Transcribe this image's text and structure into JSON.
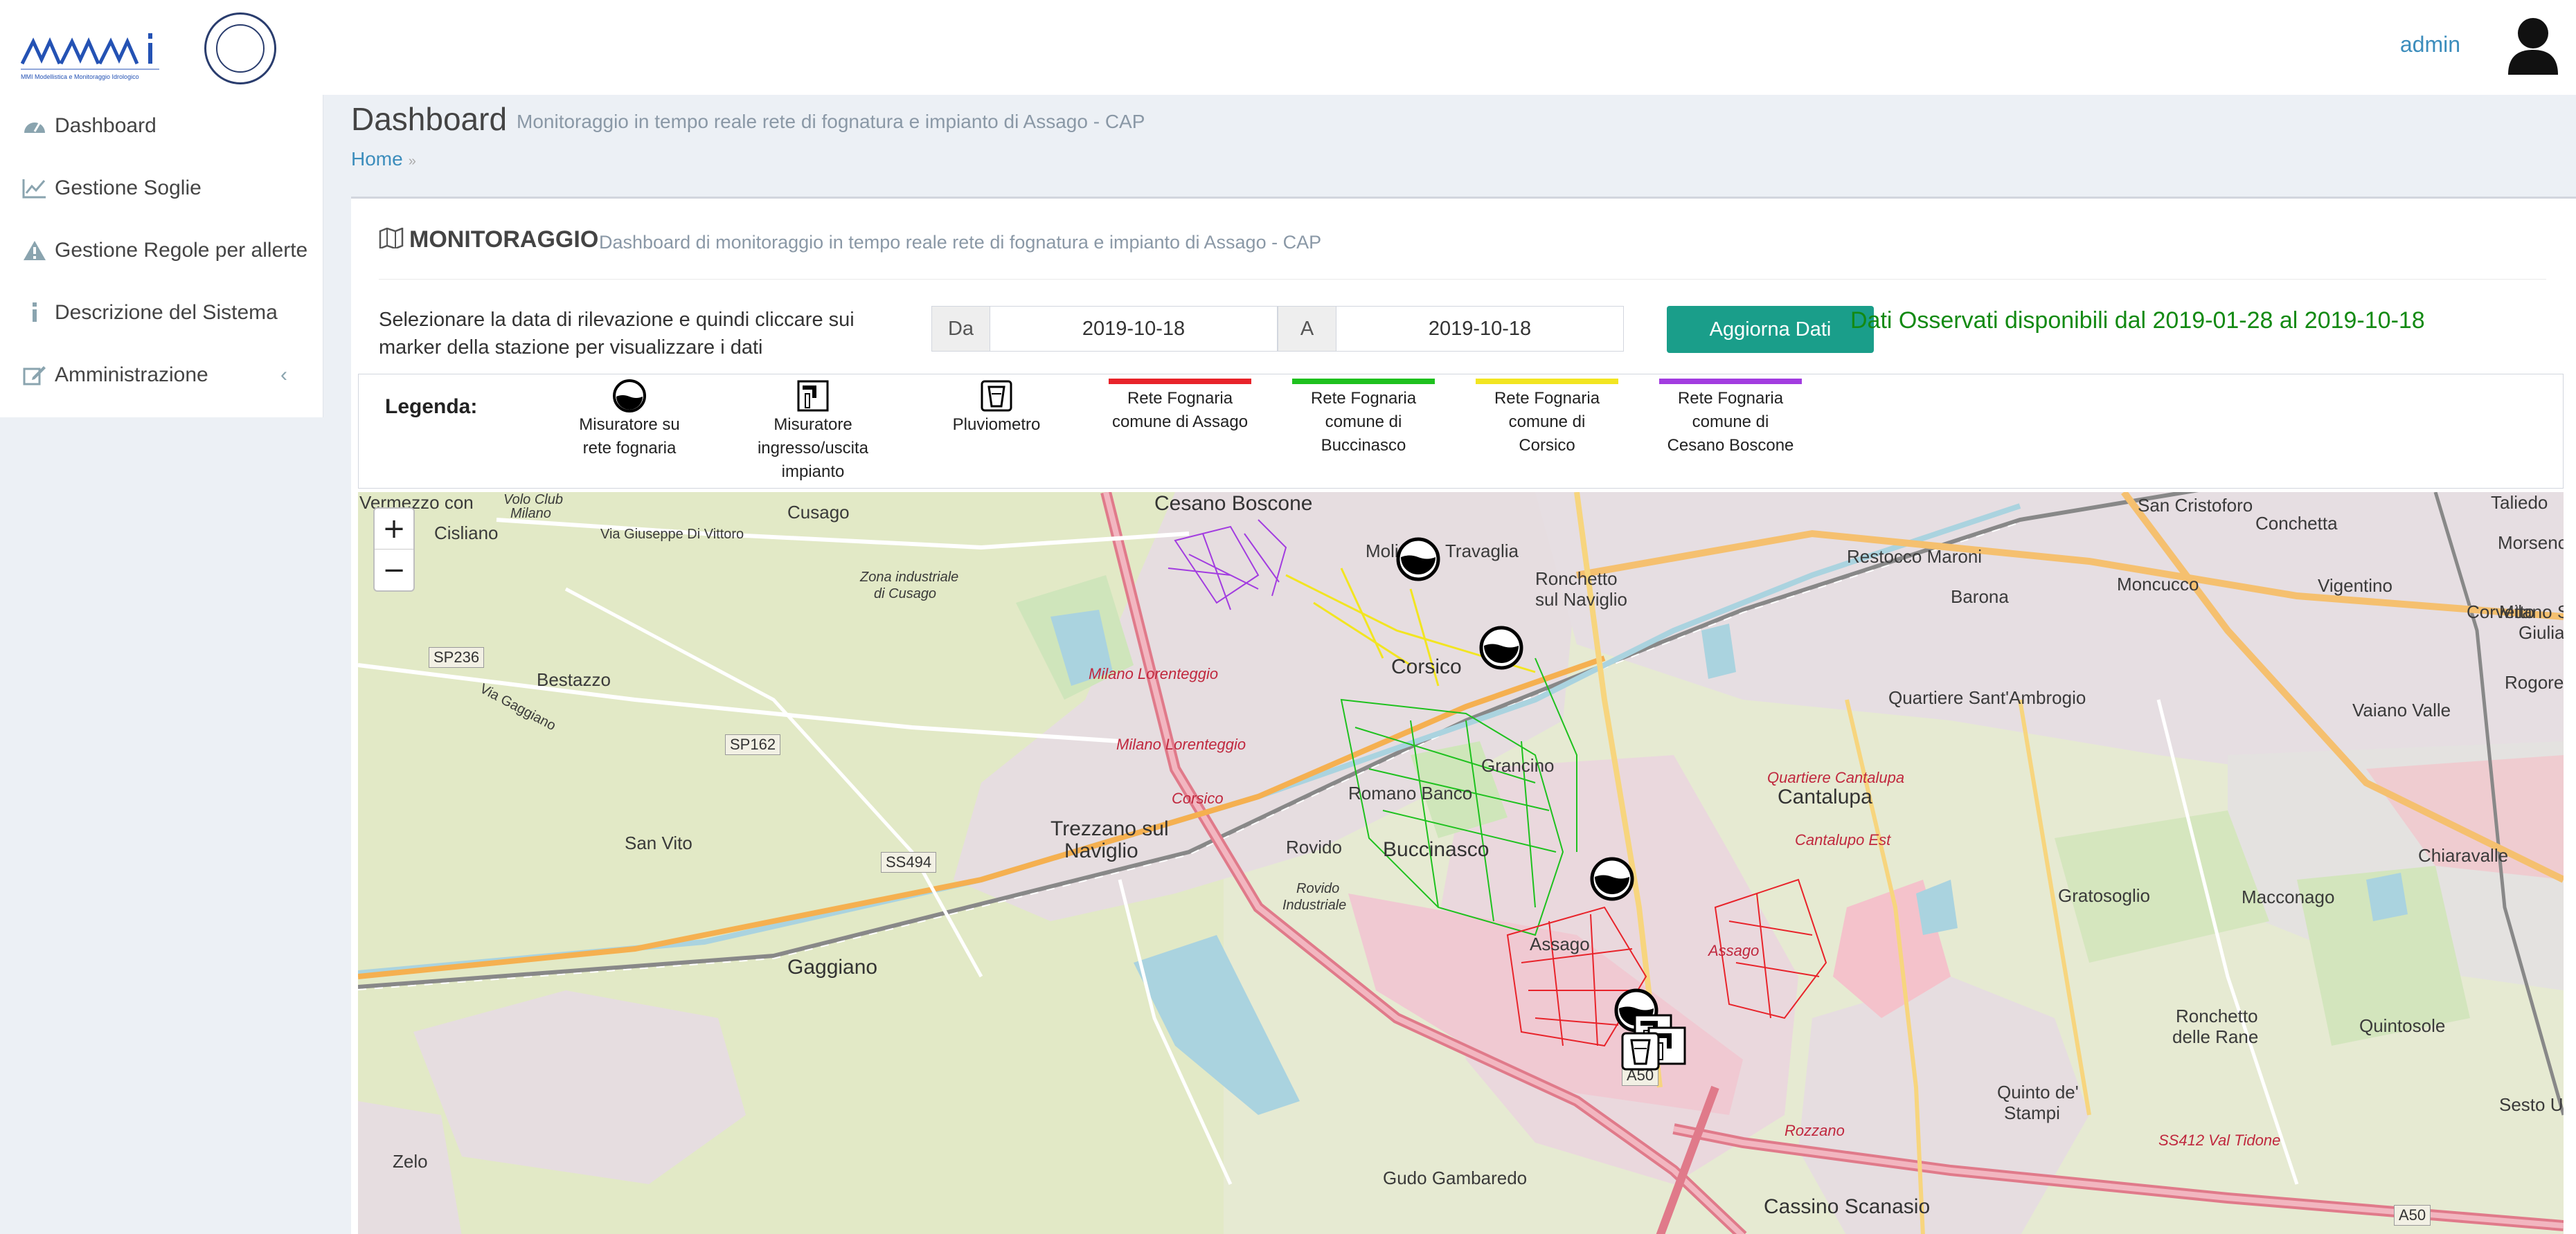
{
  "header": {
    "logo_text": "MMI Modellistica e Monitoraggio Idrologico",
    "user_name": "admin"
  },
  "sidebar": {
    "items": [
      {
        "label": "Dashboard",
        "icon": "dashboard-icon"
      },
      {
        "label": "Gestione Soglie",
        "icon": "line-chart-icon"
      },
      {
        "label": "Gestione Regole per allerte",
        "icon": "warning-icon"
      },
      {
        "label": "Descrizione del Sistema",
        "icon": "info-icon"
      },
      {
        "label": "Amministrazione",
        "icon": "edit-icon"
      }
    ]
  },
  "page": {
    "title": "Dashboard",
    "subtitle": "Monitoraggio in tempo reale rete di fognatura e impianto di Assago - CAP",
    "breadcrumb": "Home"
  },
  "box": {
    "title": "MONITORAGGIO",
    "subtitle": "Dashboard di monitoraggio in tempo reale rete di fognatura e impianto di Assago - CAP",
    "instruction_line1": "Selezionare la data di rilevazione e quindi cliccare sui",
    "instruction_line2": "marker della stazione per visualizzare i dati",
    "from_label": "Da",
    "from_value": "2019-10-18",
    "to_label": "A",
    "to_value": "2019-10-18",
    "update_button": "Aggiorna Dati",
    "observed_text": "Dati Osservati disponibili dal 2019-01-28 al 2019-10-18"
  },
  "legend": {
    "title": "Legenda:",
    "items": [
      {
        "line1": "Misuratore su",
        "line2": "rete fognaria",
        "line3": "",
        "icon": "sewer-gauge-icon"
      },
      {
        "line1": "Misuratore",
        "line2": "ingresso/uscita",
        "line3": "impianto",
        "icon": "plant-meter-icon"
      },
      {
        "line1": "Pluviometro",
        "line2": "",
        "line3": "",
        "icon": "rain-gauge-icon"
      },
      {
        "line1": "Rete Fognaria",
        "line2": "comune di Assago",
        "line3": "",
        "color": "#e8232a"
      },
      {
        "line1": "Rete Fognaria",
        "line2": "comune di",
        "line3": "Buccinasco",
        "color": "#1ec11e"
      },
      {
        "line1": "Rete Fognaria",
        "line2": "comune di",
        "line3": "Corsico",
        "color": "#f2e521"
      },
      {
        "line1": "Rete Fognaria",
        "line2": "comune di",
        "line3": "Cesano Boscone",
        "color": "#a23ce0"
      }
    ]
  },
  "map": {
    "zoom_in": "+",
    "zoom_out": "−",
    "labels": {
      "cesano_boscone": "Cesano Boscone",
      "cusago": "Cusago",
      "cisliano": "Cisliano",
      "volo_club": "Volo Club",
      "milano_top": "Milano",
      "via_vittorio": "Via Giuseppe Di Vittoro",
      "zona_industriale": "Zona industriale",
      "di_cusago": "di Cusago",
      "sp236": "SP236",
      "bestazzo": "Bestazzo",
      "sp162": "SP162",
      "via_gaggiano": "Via Gaggiano",
      "molinetto": "Molinetto",
      "travaglia": "Travaglia",
      "ronchetto": "Ronchetto",
      "sul_naviglio": "sul Naviglio",
      "corsico": "Corsico",
      "milano_lorenteggio1": "Milano Lorenteggio",
      "milano_lorenteggio2": "Milano Lorenteggio",
      "grancino": "Grancino",
      "romano_banco": "Romano Banco",
      "buccinasco": "Buccinasco",
      "rovido": "Rovido",
      "rovido_ind": "Rovido",
      "industriale": "Industriale",
      "trezzano1": "Trezzano sul",
      "trezzano2": "Naviglio",
      "corsico_red": "Corsico",
      "san_vito": "San Vito",
      "ss494": "SS494",
      "gaggiano": "Gaggiano",
      "assago": "Assago",
      "assago_red": "Assago",
      "san_cristoforo": "San Cristoforo",
      "restocco": "Restocco Maroni",
      "barona": "Barona",
      "moncucco": "Moncucco",
      "conchetta": "Conchetta",
      "vigentino": "Vigentino",
      "corvetto": "Corvetto",
      "taliedo": "Taliedo",
      "morsenchio": "Morsenchio",
      "milano_santa": "Milano Santa",
      "giulia": "Giulia",
      "rogoredo": "Rogoredo",
      "vaiano_valle": "Vaiano Valle",
      "quartiere_sant_ambrogio": "Quartiere Sant'Ambrogio",
      "quartiere_cantalupa": "Quartiere Cantalupa",
      "cantalupa": "Cantalupa",
      "cantalupo_est": "Cantalupo Est",
      "gratosoglio": "Gratosoglio",
      "macconago": "Macconago",
      "chiaravalle": "Chiaravalle",
      "ronchetto_rane1": "Ronchetto",
      "ronchetto_rane2": "delle Rane",
      "quintosole": "Quintosole",
      "quinto1": "Quinto de'",
      "quinto2": "Stampi",
      "vermezzo1": "Vermezzo con",
      "vermezzo2": "Zelo",
      "gudo": "Gudo Gambaredo",
      "cassino": "Cassino Scanasio",
      "sesto_ulteri": "Sesto Ulteri",
      "rozzano": "Rozzano",
      "ss412": "SS412 Val Tidone",
      "a50": "A50",
      "a50b": "A50"
    }
  }
}
